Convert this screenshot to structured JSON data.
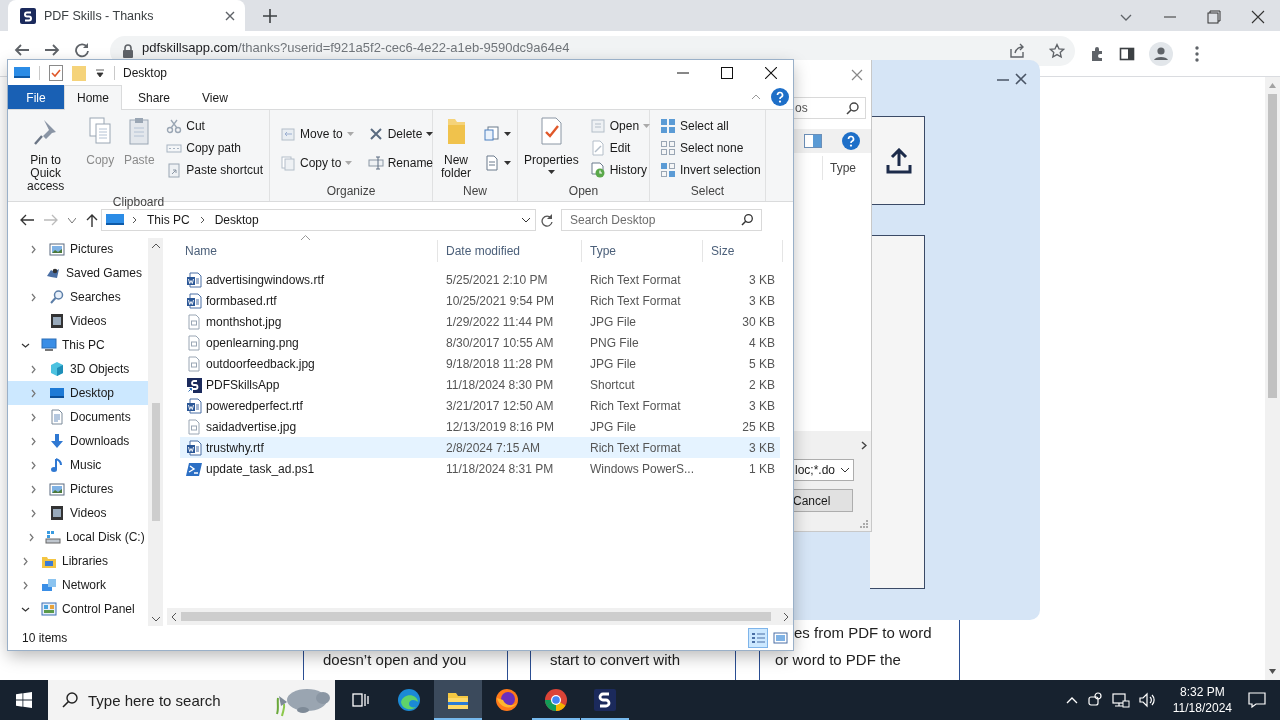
{
  "browser": {
    "tab_title": "PDF Skills - Thanks",
    "address_host": "pdfskillsapp.com",
    "address_path": "/thanks?userid=f921a5f2-cec6-4e22-a1eb-9590dc9a64e4"
  },
  "page": {
    "cards": [
      {
        "lines": [
          "doesn’t open and you"
        ]
      },
      {
        "lines": [
          "start to convert with"
        ]
      },
      {
        "lines": [
          "es from PDF to word",
          "or word to PDF the"
        ]
      }
    ]
  },
  "file_dialog": {
    "search_value": "os",
    "column_header": "Type",
    "filter_value": "loc;*.do",
    "cancel_button": "Cancel"
  },
  "explorer": {
    "title": "Desktop",
    "ribbon_tabs": [
      {
        "label": "File",
        "kind": "file",
        "selected": false
      },
      {
        "label": "Home",
        "kind": "tab",
        "selected": true
      },
      {
        "label": "Share",
        "kind": "tab",
        "selected": false
      },
      {
        "label": "View",
        "kind": "tab",
        "selected": false
      }
    ],
    "ribbon_groups": [
      {
        "label": "Clipboard",
        "commands": [
          {
            "label": "Pin to Quick access",
            "kind": "large",
            "disabled": false,
            "dropdown": false
          },
          {
            "label": "Copy",
            "kind": "large",
            "disabled": true,
            "dropdown": false
          },
          {
            "label": "Paste",
            "kind": "large",
            "disabled": true,
            "dropdown": false
          },
          {
            "label": "Cut",
            "kind": "small",
            "disabled": true,
            "dropdown": false
          },
          {
            "label": "Copy path",
            "kind": "small",
            "disabled": true,
            "dropdown": false
          },
          {
            "label": "Paste shortcut",
            "kind": "small",
            "disabled": true,
            "dropdown": false
          }
        ]
      },
      {
        "label": "Organize",
        "commands": [
          {
            "label": "Move to",
            "kind": "small",
            "disabled": true,
            "dropdown": true
          },
          {
            "label": "Copy to",
            "kind": "small",
            "disabled": true,
            "dropdown": true
          },
          {
            "label": "Delete",
            "kind": "small",
            "disabled": false,
            "dropdown": true
          },
          {
            "label": "Rename",
            "kind": "small",
            "disabled": false,
            "dropdown": false
          }
        ]
      },
      {
        "label": "New",
        "commands": [
          {
            "label": "New folder",
            "kind": "large",
            "disabled": false,
            "dropdown": false
          },
          {
            "kind": "small",
            "disabled": false,
            "dropdown": true
          },
          {
            "kind": "small",
            "disabled": false,
            "dropdown": true
          }
        ]
      },
      {
        "label": "Open",
        "commands": [
          {
            "label": "Properties",
            "kind": "large",
            "disabled": false,
            "dropdown": true
          },
          {
            "label": "Open",
            "kind": "small",
            "disabled": true,
            "dropdown": true
          },
          {
            "label": "Edit",
            "kind": "small",
            "disabled": true,
            "dropdown": false
          },
          {
            "label": "History",
            "kind": "small",
            "disabled": false,
            "dropdown": false
          }
        ]
      },
      {
        "label": "Select",
        "commands": [
          {
            "label": "Select all",
            "kind": "small",
            "disabled": false,
            "dropdown": false
          },
          {
            "label": "Select none",
            "kind": "small",
            "disabled": false,
            "dropdown": false
          },
          {
            "label": "Invert selection",
            "kind": "small",
            "disabled": false,
            "dropdown": false
          }
        ]
      }
    ],
    "breadcrumb": [
      "This PC",
      "Desktop"
    ],
    "search_placeholder": "Search Desktop",
    "nav_pane": {
      "continued_items": [
        {
          "label": "Pictures",
          "expandable": true,
          "expanded": false,
          "selected": false
        },
        {
          "label": "Saved Games",
          "expandable": false,
          "selected": false
        },
        {
          "label": "Searches",
          "expandable": true,
          "expanded": false,
          "selected": false
        },
        {
          "label": "Videos",
          "expandable": false,
          "selected": false
        }
      ],
      "items": [
        {
          "label": "This PC",
          "expandable": true,
          "expanded": true,
          "selected": false,
          "children": [
            {
              "label": "3D Objects",
              "expandable": true,
              "expanded": false,
              "selected": false
            },
            {
              "label": "Desktop",
              "expandable": true,
              "expanded": false,
              "selected": true
            },
            {
              "label": "Documents",
              "expandable": true,
              "expanded": false,
              "selected": false
            },
            {
              "label": "Downloads",
              "expandable": true,
              "expanded": false,
              "selected": false
            },
            {
              "label": "Music",
              "expandable": true,
              "expanded": false,
              "selected": false
            },
            {
              "label": "Pictures",
              "expandable": true,
              "expanded": false,
              "selected": false
            },
            {
              "label": "Videos",
              "expandable": true,
              "expanded": false,
              "selected": false
            },
            {
              "label": "Local Disk (C:)",
              "expandable": true,
              "expanded": false,
              "selected": false
            }
          ]
        },
        {
          "label": "Libraries",
          "expandable": true,
          "expanded": false,
          "selected": false
        },
        {
          "label": "Network",
          "expandable": true,
          "expanded": false,
          "selected": false
        },
        {
          "label": "Control Panel",
          "expandable": true,
          "expanded": true,
          "selected": false
        }
      ]
    },
    "columns": [
      "Name",
      "Date modified",
      "Type",
      "Size"
    ],
    "files": [
      {
        "name": "advertisingwindows.rtf",
        "date": "5/25/2021 2:10 PM",
        "type": "Rich Text Format",
        "size": "3 KB",
        "kind": "rtf",
        "selected": false
      },
      {
        "name": "formbased.rtf",
        "date": "10/25/2021 9:54 PM",
        "type": "Rich Text Format",
        "size": "3 KB",
        "kind": "rtf",
        "selected": false
      },
      {
        "name": "monthshot.jpg",
        "date": "1/29/2022 11:44 PM",
        "type": "JPG File",
        "size": "30 KB",
        "kind": "image",
        "selected": false
      },
      {
        "name": "openlearning.png",
        "date": "8/30/2017 10:55 AM",
        "type": "PNG File",
        "size": "4 KB",
        "kind": "image",
        "selected": false
      },
      {
        "name": "outdoorfeedback.jpg",
        "date": "9/18/2018 11:28 PM",
        "type": "JPG File",
        "size": "5 KB",
        "kind": "image",
        "selected": false
      },
      {
        "name": "PDFSkillsApp",
        "date": "11/18/2024 8:30 PM",
        "type": "Shortcut",
        "size": "2 KB",
        "kind": "shortcut",
        "selected": false
      },
      {
        "name": "poweredperfect.rtf",
        "date": "3/21/2017 12:50 AM",
        "type": "Rich Text Format",
        "size": "3 KB",
        "kind": "rtf",
        "selected": false
      },
      {
        "name": "saidadvertise.jpg",
        "date": "12/13/2019 8:16 PM",
        "type": "JPG File",
        "size": "25 KB",
        "kind": "image",
        "selected": false
      },
      {
        "name": "trustwhy.rtf",
        "date": "2/8/2024 7:15 AM",
        "type": "Rich Text Format",
        "size": "3 KB",
        "kind": "rtf",
        "selected": true
      },
      {
        "name": "update_task_ad.ps1",
        "date": "11/18/2024 8:31 PM",
        "type": "Windows PowerS...",
        "size": "1 KB",
        "kind": "script",
        "selected": false
      }
    ],
    "status": "10 items",
    "view_buttons": [
      {
        "selected": true
      },
      {
        "selected": false
      }
    ]
  },
  "taskbar": {
    "search_placeholder": "Type here to search",
    "apps": [
      {
        "running": false,
        "active": false
      },
      {
        "running": true,
        "active": true
      },
      {
        "running": false,
        "active": false
      },
      {
        "running": true,
        "active": false
      },
      {
        "running": true,
        "active": false
      }
    ],
    "time": "8:32 PM",
    "date": "11/18/2024"
  }
}
